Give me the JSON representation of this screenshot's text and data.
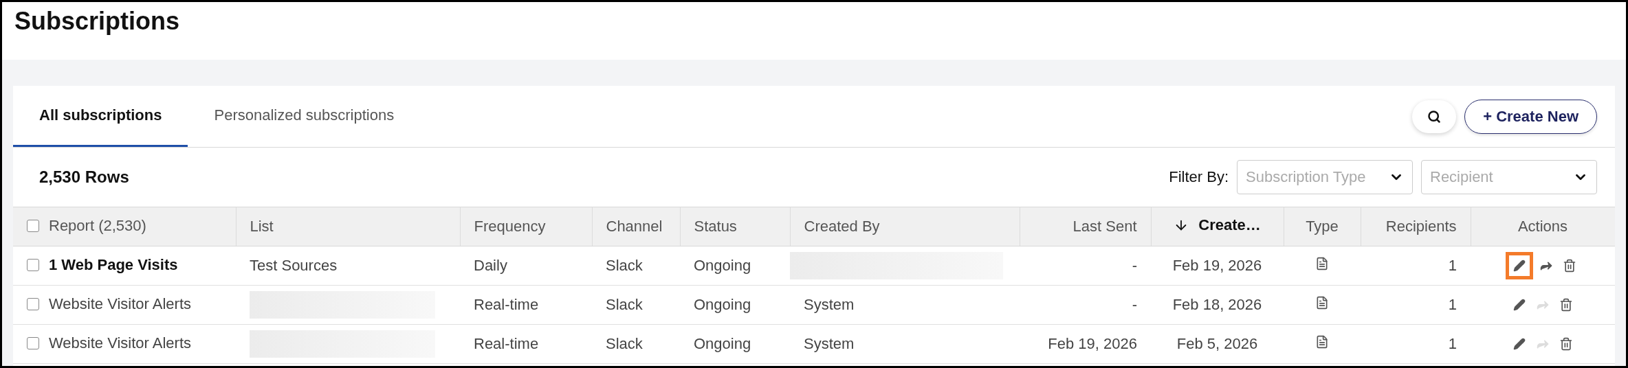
{
  "page": {
    "title": "Subscriptions"
  },
  "tabs": [
    {
      "label": "All subscriptions",
      "selected": true
    },
    {
      "label": "Personalized subscriptions",
      "selected": false
    }
  ],
  "create_button": "+ Create New",
  "row_count": "2,530 Rows",
  "filter": {
    "label": "Filter By:",
    "dropdowns": [
      {
        "placeholder": "Subscription Type"
      },
      {
        "placeholder": "Recipient"
      }
    ]
  },
  "table": {
    "all_checked": false,
    "columns": [
      {
        "label": "Report (2,530)",
        "kind": "check"
      },
      {
        "label": "List",
        "kind": "plain"
      },
      {
        "label": "Frequency",
        "kind": "plain"
      },
      {
        "label": "Channel",
        "kind": "plain"
      },
      {
        "label": "Status",
        "kind": "plain"
      },
      {
        "label": "Created By",
        "kind": "plain"
      },
      {
        "label": "Last Sent",
        "kind": "plain"
      },
      {
        "label": "Create…",
        "kind": "sorted"
      },
      {
        "label": "Type",
        "kind": "plain"
      },
      {
        "label": "Recipients",
        "kind": "plain"
      },
      {
        "label": "Actions",
        "kind": "plain"
      }
    ],
    "rows": [
      {
        "checked": false,
        "report": "1 Web Page Visits",
        "report_bold": true,
        "list": "Test Sources",
        "list_redacted": false,
        "frequency": "Daily",
        "channel": "Slack",
        "status": "Ongoing",
        "created_by_redacted": true,
        "last_sent": "-",
        "created": "Feb 19, 2026",
        "recipients": "1",
        "edit_highlighted": true,
        "share_disabled": false
      },
      {
        "checked": false,
        "report": "Website Visitor Alerts",
        "report_bold": false,
        "list_redacted": true,
        "frequency": "Real-time",
        "channel": "Slack",
        "status": "Ongoing",
        "created_by": "System",
        "created_by_redacted": false,
        "last_sent": "-",
        "created": "Feb 18, 2026",
        "recipients": "1",
        "edit_highlighted": false,
        "share_disabled": true
      },
      {
        "checked": false,
        "report": "Website Visitor Alerts",
        "report_bold": false,
        "list_redacted": true,
        "frequency": "Real-time",
        "channel": "Slack",
        "status": "Ongoing",
        "created_by": "System",
        "created_by_redacted": false,
        "last_sent": "Feb 19, 2026",
        "created": "Feb 5, 2026",
        "recipients": "1",
        "edit_highlighted": false,
        "share_disabled": true
      }
    ]
  }
}
